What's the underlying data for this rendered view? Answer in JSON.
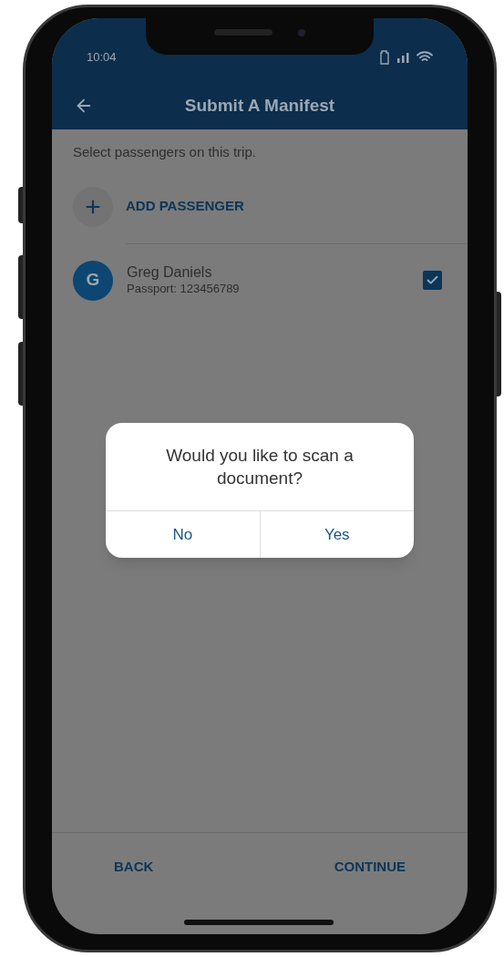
{
  "status_bar": {
    "time": "10:04"
  },
  "header": {
    "title": "Submit A Manifest"
  },
  "instructions": "Select passengers on this trip.",
  "add_button": {
    "label": "ADD PASSENGER"
  },
  "passengers": [
    {
      "initial": "G",
      "name": "Greg Daniels",
      "detail": "Passport: 123456789",
      "checked": true
    }
  ],
  "dialog": {
    "message": "Would you like to scan a document?",
    "buttons": [
      "No",
      "Yes"
    ]
  },
  "footer": {
    "buttons": [
      "BACK",
      "CONTINUE"
    ]
  }
}
